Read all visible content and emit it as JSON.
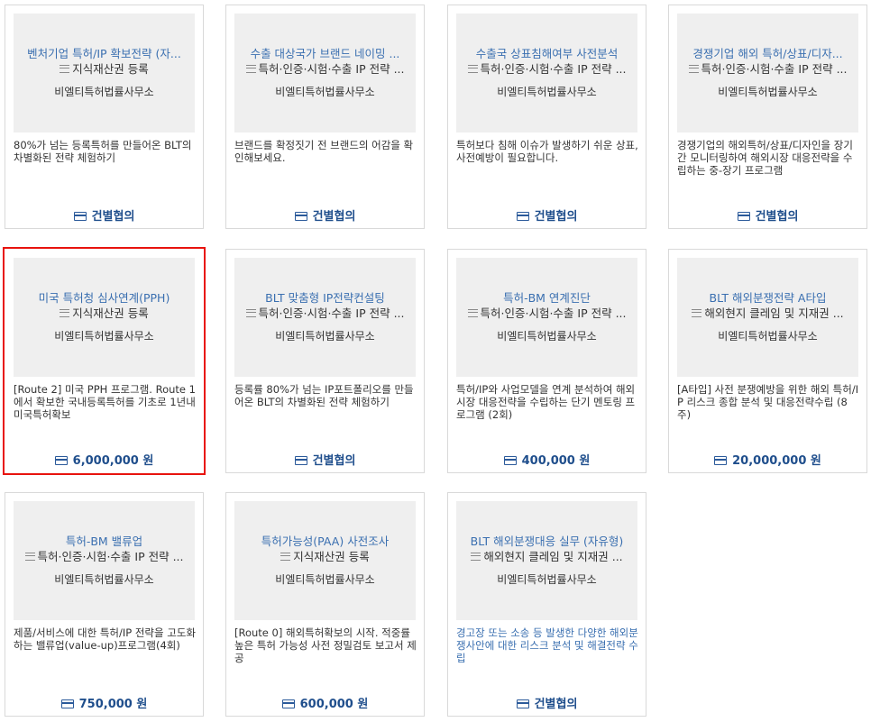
{
  "products": [
    {
      "title": "벤처기업 특허/IP 확보전략 (자...",
      "category": "지식재산권 등록",
      "firm": "비엘티특허법률사무소",
      "description": "80%가 넘는 등록특허를 만들어온 BLT의 차별화된 전략 체험하기",
      "price": "건별협의"
    },
    {
      "title": "수출 대상국가 브랜드 네이밍 ...",
      "category": "특허·인증·시험·수출 IP 전략 ...",
      "firm": "비엘티특허법률사무소",
      "description": "브랜드를 확정짓기 전 브랜드의 어감을 확인해보세요.",
      "price": "건별협의"
    },
    {
      "title": "수출국 상표침해여부 사전분석",
      "category": "특허·인증·시험·수출 IP 전략 ...",
      "firm": "비엘티특허법률사무소",
      "description": "특허보다 침해 이슈가 발생하기 쉬운 상표, 사전예방이 필요합니다.",
      "price": "건별협의"
    },
    {
      "title": "경쟁기업 해외 특허/상표/디자...",
      "category": "특허·인증·시험·수출 IP 전략 ...",
      "firm": "비엘티특허법률사무소",
      "description": "경쟁기업의 해외특허/상표/디자인을 장기간 모니터링하여 해외시장 대응전략을 수립하는 중-장기 프로그램",
      "price": "건별협의"
    },
    {
      "title": "미국 특허청 심사연계(PPH)",
      "category": "지식재산권 등록",
      "firm": "비엘티특허법률사무소",
      "description": "[Route 2] 미국 PPH 프로그램. Route 1에서 확보한 국내등록특허를 기초로 1년내 미국특허확보",
      "price": "6,000,000 원"
    },
    {
      "title": "BLT 맞춤형 IP전략컨설팅",
      "category": "특허·인증·시험·수출 IP 전략 ...",
      "firm": "비엘티특허법률사무소",
      "description": "등록률 80%가 넘는 IP포트폴리오를 만들어온 BLT의 차별화된 전략 체험하기",
      "price": "건별협의"
    },
    {
      "title": "특허-BM 연계진단",
      "category": "특허·인증·시험·수출 IP 전략 ...",
      "firm": "비엘티특허법률사무소",
      "description": "특허/IP와 사업모델을 연계 분석하여 해외시장 대응전략을 수립하는 단기 멘토링 프로그램 (2회)",
      "price": "400,000 원"
    },
    {
      "title": "BLT 해외분쟁전략 A타입",
      "category": "해외현지 클레임 및 지재권 ...",
      "firm": "비엘티특허법률사무소",
      "description": "[A타입] 사전 분쟁예방을 위한 해외 특허/IP 리스크 종합 분석 및 대응전략수립 (8주)",
      "price": "20,000,000 원"
    },
    {
      "title": "특허-BM 밸류업",
      "category": "특허·인증·시험·수출 IP 전략 ...",
      "firm": "비엘티특허법률사무소",
      "description": "제품/서비스에 대한 특허/IP 전략을 고도화하는 밸류업(value-up)프로그램(4회)",
      "price": "750,000 원"
    },
    {
      "title": "특허가능성(PAA) 사전조사",
      "category": "지식재산권 등록",
      "firm": "비엘티특허법률사무소",
      "description": "[Route 0] 해외특허확보의 시작. 적중률 높은 특허 가능성 사전 정밀검토 보고서 제공",
      "price": "600,000 원"
    },
    {
      "title": "BLT 해외분쟁대응 실무 (자유형)",
      "category": "해외현지 클레임 및 지재권 ...",
      "firm": "비엘티특허법률사무소",
      "description": "경고장 또는 소송 등 발생한 다양한 해외분쟁사안에 대한 리스크 분석 및 해결전략 수립",
      "price": "건별협의"
    }
  ]
}
